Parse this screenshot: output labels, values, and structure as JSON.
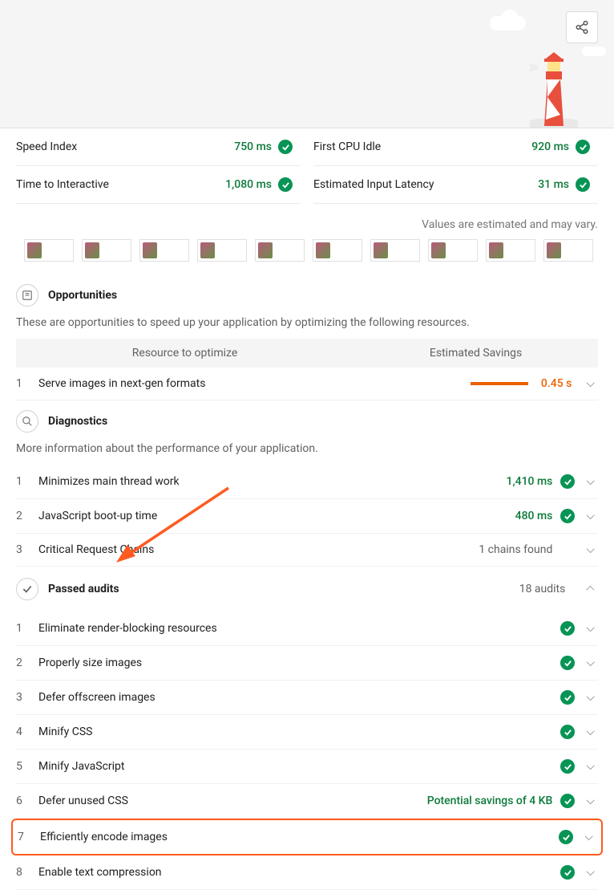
{
  "metrics_left": [
    {
      "label": "Speed Index",
      "value": "750 ms"
    },
    {
      "label": "Time to Interactive",
      "value": "1,080 ms"
    }
  ],
  "metrics_right": [
    {
      "label": "First CPU Idle",
      "value": "920 ms"
    },
    {
      "label": "Estimated Input Latency",
      "value": "31 ms"
    }
  ],
  "values_note": "Values are estimated and may vary.",
  "opportunities": {
    "title": "Opportunities",
    "desc": "These are opportunities to speed up your application by optimizing the following resources.",
    "col1": "Resource to optimize",
    "col2": "Estimated Savings",
    "items": [
      {
        "num": "1",
        "label": "Serve images in next-gen formats",
        "savings": "0.45 s"
      }
    ]
  },
  "diagnostics": {
    "title": "Diagnostics",
    "desc": "More information about the performance of your application.",
    "items": [
      {
        "num": "1",
        "label": "Minimizes main thread work",
        "value": "1,410 ms",
        "pass": true
      },
      {
        "num": "2",
        "label": "JavaScript boot-up time",
        "value": "480 ms",
        "pass": true
      },
      {
        "num": "3",
        "label": "Critical Request Chains",
        "value": "1 chains found",
        "pass": false
      }
    ]
  },
  "passed": {
    "title": "Passed audits",
    "count": "18 audits",
    "items": [
      {
        "num": "1",
        "label": "Eliminate render-blocking resources"
      },
      {
        "num": "2",
        "label": "Properly size images"
      },
      {
        "num": "3",
        "label": "Defer offscreen images"
      },
      {
        "num": "4",
        "label": "Minify CSS"
      },
      {
        "num": "5",
        "label": "Minify JavaScript"
      },
      {
        "num": "6",
        "label": "Defer unused CSS",
        "value": "Potential savings of 4 KB"
      },
      {
        "num": "7",
        "label": "Efficiently encode images",
        "highlight": true
      },
      {
        "num": "8",
        "label": "Enable text compression"
      }
    ]
  }
}
